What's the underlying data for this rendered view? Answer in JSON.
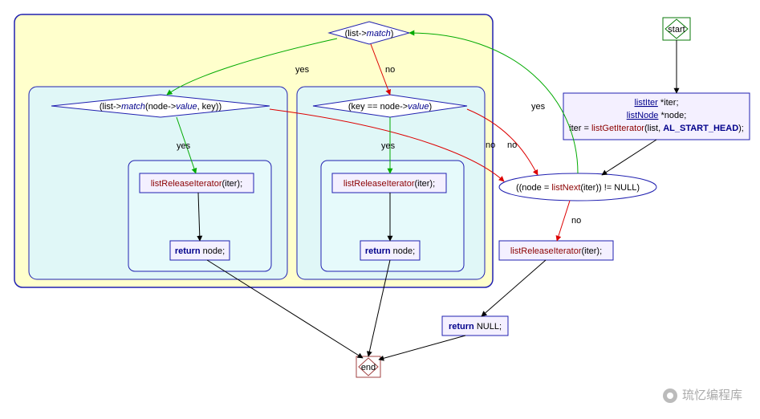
{
  "terminals": {
    "start": "start",
    "end": "end"
  },
  "init": {
    "line1a": "listIter",
    "line1b": " *iter;",
    "line2a": "listNode",
    "line2b": " *node;",
    "line3a": "iter = ",
    "line3b": "listGetIterator",
    "line3c": "(list, ",
    "line3d": "AL_START_HEAD",
    "line3e": ");"
  },
  "loop": {
    "cond_a": "((node = ",
    "cond_b": "listNext",
    "cond_c": "(iter)) != NULL)"
  },
  "outerDecision": {
    "a": "(list->",
    "b": "match",
    "c": ")"
  },
  "leftDecision": {
    "a": "(list->",
    "b": "match",
    "c": "(node->",
    "d": "value",
    "e": ", key))"
  },
  "rightDecision": {
    "a": "(key == node->",
    "b": "value",
    "c": ")"
  },
  "release": {
    "a": "listReleaseIterator",
    "b": "(iter);"
  },
  "retNode": {
    "a": "return",
    "b": " node;"
  },
  "retNull": {
    "a": "return",
    "b": " NULL;"
  },
  "labels": {
    "yes": "yes",
    "no": "no"
  },
  "watermark": "琉忆编程库"
}
